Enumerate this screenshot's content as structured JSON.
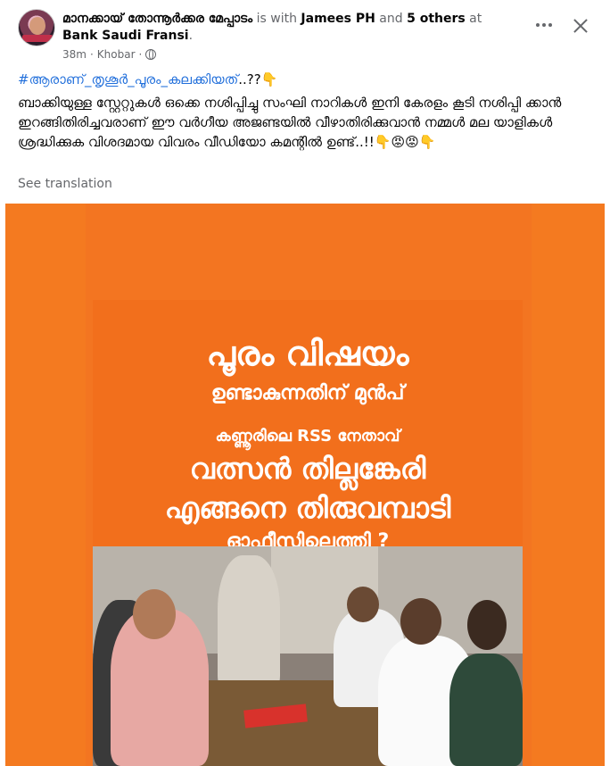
{
  "post": {
    "author": "മാനക്കായ് തോന്നൂർക്കര മേപ്പാടം",
    "with_text": " is with ",
    "tagged_person": "Jamees PH",
    "and_text": " and ",
    "others": "5 others",
    "at_text": " at",
    "place": "Bank Saudi Fransi",
    "place_suffix": ".",
    "time": "38m",
    "separator1": "·",
    "location": "Khobar",
    "separator2": "·",
    "hashtag": "#ആരാണ്_തൃശൂർ_പൂരം_കലക്കിയത്",
    "hashtag_tail": "..??👇",
    "body": "ബാക്കിയുള്ള സ്റ്റേറ്റുകൾ ഒക്കെ നശിപ്പിച്ചു സംഘി നാറികൾ ഇനി കേരളം കൂടി നശിപ്പി ക്കാൻ ഇറങ്ങിതിരിച്ചവരാണ് ഈ വർഗീയ അജണ്ടയിൽ വീഴാതിരിക്കുവാൻ നമ്മൾ മല യാളികൾ ശ്രദ്ധിക്കുക വിശദമായ വിവരം വീഡിയോ കമന്റിൽ ഉണ്ട്..!!👇😡😡👇",
    "see_translation": "See translation"
  },
  "poster": {
    "line1": "പൂരം വിഷയം",
    "line2": "ഉണ്ടാകുന്നതിന് മുൻപ്",
    "line3": "കണ്ണൂരിലെ RSS നേതാവ്",
    "line4": "വത്സൻ തില്ലങ്കേരി",
    "line5": "എങ്ങനെ തിരുവമ്പാടി",
    "line6": "ഓഫീസിലെത്തി ?"
  },
  "colors": {
    "link_blue": "#216fdb",
    "poster_orange": "#f26f1c",
    "text_secondary": "#65676b"
  }
}
